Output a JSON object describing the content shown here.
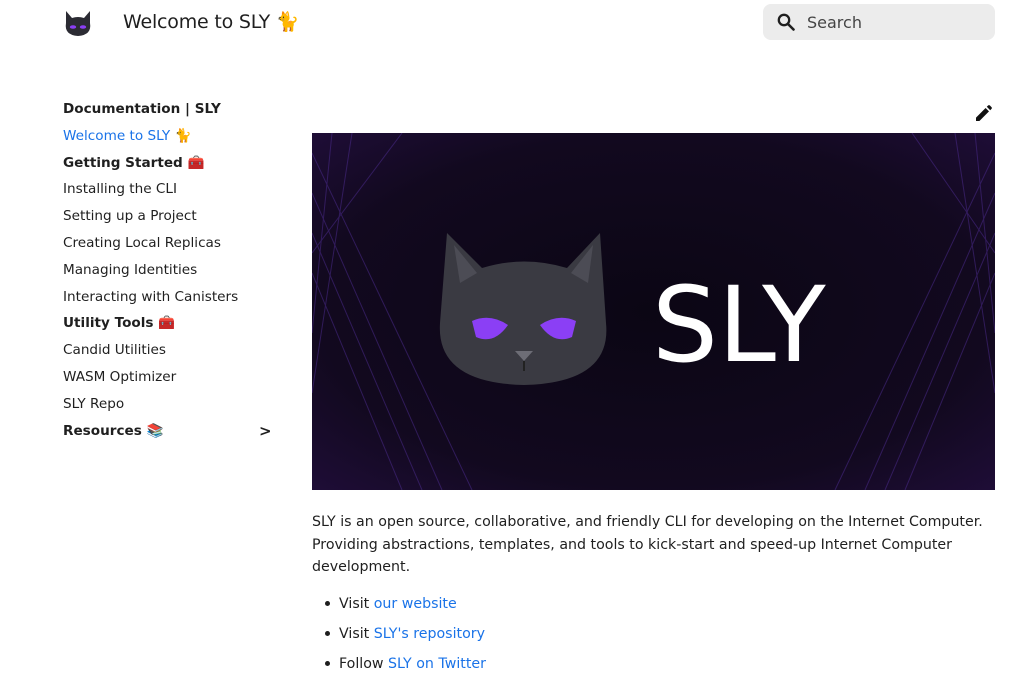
{
  "header": {
    "logo": "sly-cat-logo",
    "title": "Welcome to SLY 🐈",
    "search_placeholder": "Search",
    "search_icon": "magnifier"
  },
  "sidebar": {
    "heading": "Documentation | SLY",
    "items": [
      {
        "label": "Welcome to SLY 🐈",
        "type": "link",
        "active": true
      },
      {
        "label": "Getting Started 🧰",
        "type": "section"
      },
      {
        "label": "Installing the CLI",
        "type": "link"
      },
      {
        "label": "Setting up a Project",
        "type": "link"
      },
      {
        "label": "Creating Local Replicas",
        "type": "link"
      },
      {
        "label": "Managing Identities",
        "type": "link"
      },
      {
        "label": "Interacting with Canisters",
        "type": "link"
      },
      {
        "label": "Utility Tools 🧰",
        "type": "section"
      },
      {
        "label": "Candid Utilities",
        "type": "link"
      },
      {
        "label": "WASM Optimizer",
        "type": "link"
      },
      {
        "label": "SLY Repo",
        "type": "link"
      },
      {
        "label": "Resources 📚",
        "type": "section",
        "collapsible": true,
        "chevron": ">"
      }
    ]
  },
  "main": {
    "edit_icon": "pencil",
    "banner": {
      "wordmark": "SLY",
      "image": "cat-mascot-purple-eyes"
    },
    "intro": "SLY is an open source, collaborative, and friendly CLI for developing on the Internet Computer. Providing abstractions, templates, and tools to kick-start and speed-up Internet Computer development.",
    "links": [
      {
        "prefix": "Visit ",
        "link_text": "our website"
      },
      {
        "prefix": "Visit ",
        "link_text": "SLY's repository"
      },
      {
        "prefix": "Follow ",
        "link_text": "SLY on Twitter"
      }
    ]
  },
  "colors": {
    "link": "#1a73e8",
    "text": "#1f1f1f",
    "search_bg": "#ececec",
    "banner_bg": "#160b2a",
    "cat_eyes": "#8b3ff5"
  }
}
